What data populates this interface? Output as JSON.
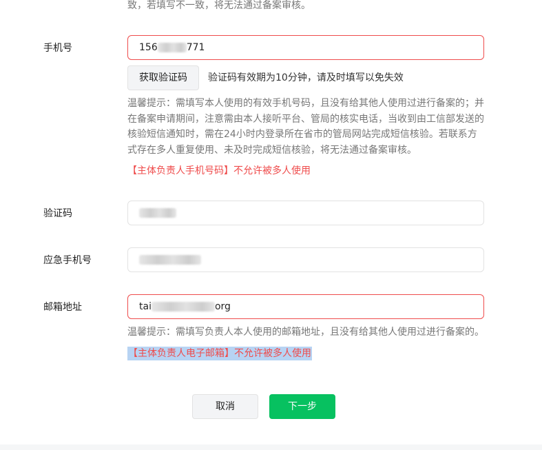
{
  "top_note": "致，若填写不一致，将无法通过备案审核。",
  "phone": {
    "label": "手机号",
    "value_prefix": "156",
    "value_suffix": "771",
    "get_code_button": "获取验证码",
    "code_validity": "验证码有效期为10分钟，请及时填写以免失效",
    "hint_lines": [
      "温馨提示：需填写本人使用的有效手机号码，且没有给其他人使用过进行备案的；并",
      "在备案申请期间，注意需由本人接听平台、管局的核实电话，当收到由工信部发送的",
      "核验短信通知时，需在24小时内登录所在省市的管局网站完成短信核验。若联系方",
      "式存在多人重复使用、未及时完成短信核验，将无法通过备案审核。"
    ],
    "warning": "【主体负责人手机号码】不允许被多人使用"
  },
  "verify_code": {
    "label": "验证码"
  },
  "emergency_phone": {
    "label": "应急手机号"
  },
  "email": {
    "label": "邮箱地址",
    "value_prefix": "tai",
    "value_suffix": "org",
    "hint": "温馨提示：需填写负责人本人使用的邮箱地址，且没有给其他人使用过进行备案的。",
    "warning": "【主体负责人电子邮箱】不允许被多人使用"
  },
  "actions": {
    "cancel": "取消",
    "next": "下一步"
  },
  "colors": {
    "primary": "#07c160",
    "error": "#ef4b4b",
    "hint": "#777777",
    "selection": "#b7d3f3"
  }
}
